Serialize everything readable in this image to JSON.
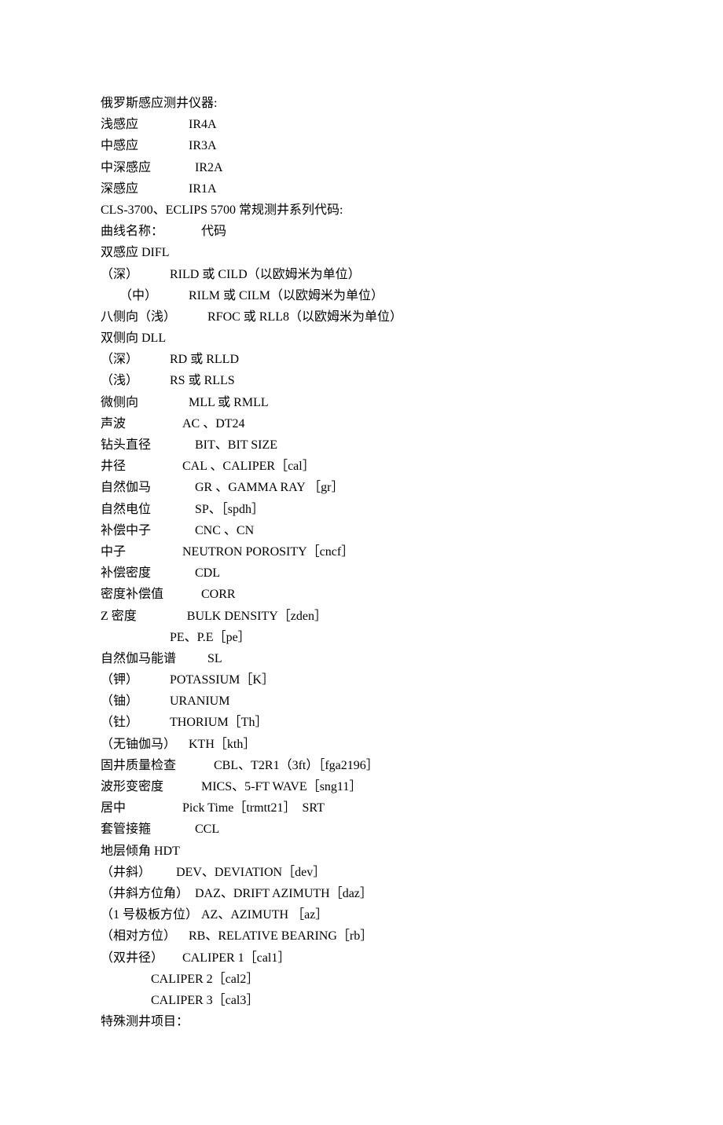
{
  "lines": [
    "俄罗斯感应测井仪器:",
    "浅感应                IR4A",
    "中感应                IR3A",
    "中深感应              IR2A",
    "深感应                IR1A",
    "CLS-3700、ECLIPS 5700 常规测井系列代码:",
    "曲线名称：            代码",
    "双感应 DIFL",
    "（深）          RILD 或 CILD（以欧姆米为单位）",
    "      （中）          RILM 或 CILM（以欧姆米为单位）",
    "八侧向（浅）          RFOC 或 RLL8（以欧姆米为单位）",
    "双侧向 DLL",
    "（深）          RD 或 RLLD",
    "（浅）          RS 或 RLLS",
    "微侧向                MLL 或 RMLL",
    "声波                  AC 、DT24",
    "钻头直径              BIT、BIT SIZE",
    "井径                  CAL 、CALIPER［cal］",
    "自然伽马              GR 、GAMMA RAY ［gr］",
    "自然电位              SP、［spdh］",
    "补偿中子              CNC 、CN",
    "中子                  NEUTRON POROSITY［cncf］",
    "补偿密度              CDL",
    "密度补偿值            CORR",
    "Z 密度                BULK DENSITY［zden］",
    "                      PE、P.E［pe］",
    "自然伽马能谱          SL",
    "（钾）          POTASSIUM［K］",
    "（铀）          URANIUM",
    "（钍）          THORIUM［Th］",
    "（无铀伽马）    KTH［kth］",
    "固井质量检查            CBL、T2R1（3ft）［fga2196］",
    "波形变密度            MICS、5-FT WAVE［sng11］",
    "居中                  Pick Time［trmtt21］  SRT",
    "套管接箍              CCL",
    "地层倾角 HDT",
    "（井斜）        DEV、DEVIATION［dev］",
    "（井斜方位角）  DAZ、DRIFT AZIMUTH［daz］",
    "（1 号极板方位） AZ、AZIMUTH ［az］",
    "（相对方位）    RB、RELATIVE BEARING［rb］",
    "（双井径）      CALIPER 1［cal1］",
    "                CALIPER 2［cal2］",
    "                CALIPER 3［cal3］",
    "特殊测井项目："
  ]
}
